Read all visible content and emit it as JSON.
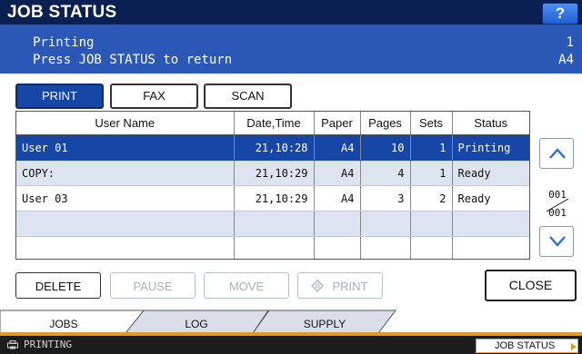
{
  "header": {
    "title": "JOB STATUS",
    "help_label": "?"
  },
  "status": {
    "line1": "Printing",
    "line2": "Press JOB STATUS to return",
    "copies": "1",
    "paper": "A4"
  },
  "modes": [
    {
      "label": "PRINT",
      "active": true
    },
    {
      "label": "FAX",
      "active": false
    },
    {
      "label": "SCAN",
      "active": false
    }
  ],
  "table": {
    "columns": [
      "User Name",
      "Date,Time",
      "Paper",
      "Pages",
      "Sets",
      "Status"
    ],
    "rows": [
      {
        "user": "User 01",
        "datetime": "21,10:28",
        "paper": "A4",
        "pages": "10",
        "sets": "1",
        "status": "Printing",
        "selected": true
      },
      {
        "user": "COPY:",
        "datetime": "21,10:29",
        "paper": "A4",
        "pages": "4",
        "sets": "1",
        "status": "Ready",
        "selected": false
      },
      {
        "user": "User 03",
        "datetime": "21,10:29",
        "paper": "A4",
        "pages": "3",
        "sets": "2",
        "status": "Ready",
        "selected": false
      },
      {
        "user": "",
        "datetime": "",
        "paper": "",
        "pages": "",
        "sets": "",
        "status": "",
        "selected": false
      },
      {
        "user": "",
        "datetime": "",
        "paper": "",
        "pages": "",
        "sets": "",
        "status": "",
        "selected": false
      }
    ]
  },
  "pagination": {
    "current": "001",
    "total": "001"
  },
  "actions": {
    "delete": "DELETE",
    "pause": "PAUSE",
    "move": "MOVE",
    "print": "PRINT",
    "close": "CLOSE"
  },
  "tabs": [
    {
      "label": "JOBS",
      "active": true
    },
    {
      "label": "LOG",
      "active": false
    },
    {
      "label": "SUPPLY",
      "active": false
    }
  ],
  "footer": {
    "status_text": "PRINTING",
    "job_status_label": "JOB STATUS"
  },
  "colors": {
    "title_bar": "#0a1f52",
    "status_area": "#2b57b6",
    "selected_row": "#1747a6",
    "accent": "#e39a25"
  }
}
